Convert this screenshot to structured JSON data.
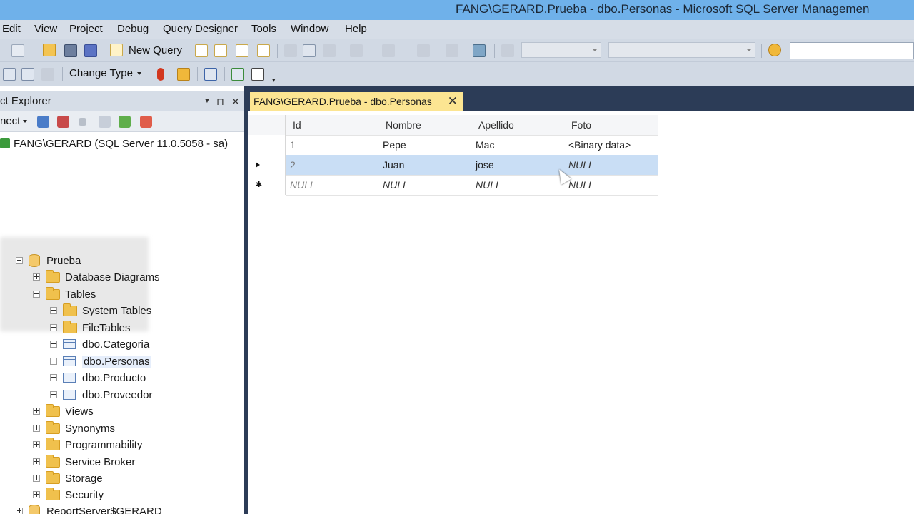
{
  "window": {
    "title": "FANG\\GERARD.Prueba - dbo.Personas - Microsoft SQL Server Managemen"
  },
  "menu": {
    "items": [
      "Edit",
      "View",
      "Project",
      "Debug",
      "Query Designer",
      "Tools",
      "Window",
      "Help"
    ]
  },
  "toolbar": {
    "new_query": "New Query",
    "change_type": "Change Type"
  },
  "object_explorer": {
    "title": "ct Explorer",
    "connect_label": "nect",
    "server": "FANG\\GERARD (SQL Server 11.0.5058 - sa)",
    "tree": [
      {
        "label": "Prueba",
        "icon": "database-icon"
      },
      {
        "label": "Database Diagrams",
        "icon": "folder-icon"
      },
      {
        "label": "Tables",
        "icon": "folder-icon"
      },
      {
        "label": "System Tables",
        "icon": "folder-icon"
      },
      {
        "label": "FileTables",
        "icon": "folder-icon"
      },
      {
        "label": "dbo.Categoria",
        "icon": "table-icon"
      },
      {
        "label": "dbo.Personas",
        "icon": "table-icon"
      },
      {
        "label": "dbo.Producto",
        "icon": "table-icon"
      },
      {
        "label": "dbo.Proveedor",
        "icon": "table-icon"
      },
      {
        "label": "Views",
        "icon": "folder-icon"
      },
      {
        "label": "Synonyms",
        "icon": "folder-icon"
      },
      {
        "label": "Programmability",
        "icon": "folder-icon"
      },
      {
        "label": "Service Broker",
        "icon": "folder-icon"
      },
      {
        "label": "Storage",
        "icon": "folder-icon"
      },
      {
        "label": "Security",
        "icon": "folder-icon"
      },
      {
        "label": "ReportServer$GERARD",
        "icon": "database-icon"
      }
    ]
  },
  "document": {
    "tab_label": "FANG\\GERARD.Prueba - dbo.Personas",
    "close_glyph": "✕",
    "columns": [
      "Id",
      "Nombre",
      "Apellido",
      "Foto"
    ],
    "rows": [
      {
        "Id": "1",
        "Nombre": "Pepe",
        "Apellido": "Mac",
        "Foto": "<Binary data>"
      },
      {
        "Id": "2",
        "Nombre": "Juan",
        "Apellido": "jose",
        "Foto": "NULL"
      },
      {
        "Id": "NULL",
        "Nombre": "NULL",
        "Apellido": "NULL",
        "Foto": "NULL"
      }
    ]
  }
}
